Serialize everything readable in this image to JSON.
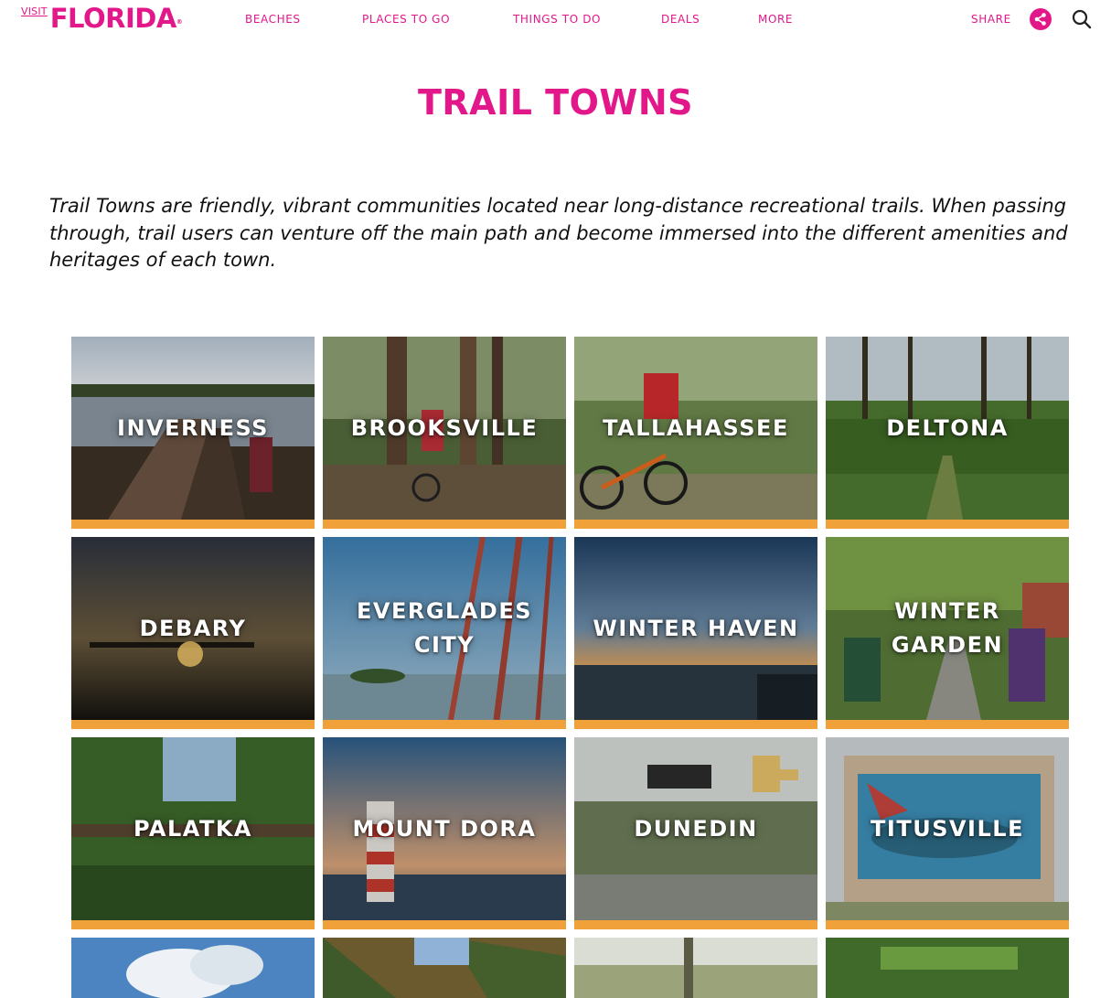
{
  "brand": {
    "visit": "VISIT",
    "name": "FLORIDA",
    "mark": "®",
    "color": "#e2178a"
  },
  "nav": [
    {
      "label": "BEACHES"
    },
    {
      "label": "PLACES TO GO"
    },
    {
      "label": "THINGS TO DO"
    },
    {
      "label": "DEALS"
    },
    {
      "label": "MORE"
    }
  ],
  "header_actions": {
    "share_label": "SHARE",
    "share_icon": "share-icon",
    "search_icon": "search-icon"
  },
  "page": {
    "title": "TRAIL TOWNS",
    "intro": "Trail Towns are friendly, vibrant communities located near long-distance recreational trails. When passing through, trail users can venture off the main path and become immersed into the different amenities and heritages of each town."
  },
  "colors": {
    "accent": "#e2178a",
    "tile_bar": "#f0a13a",
    "text": "#111111"
  },
  "towns": [
    {
      "name": "INVERNESS"
    },
    {
      "name": "BROOKSVILLE"
    },
    {
      "name": "TALLAHASSEE"
    },
    {
      "name": "DELTONA"
    },
    {
      "name": "DEBARY"
    },
    {
      "name": "EVERGLADES CITY"
    },
    {
      "name": "WINTER HAVEN"
    },
    {
      "name": "WINTER GARDEN"
    },
    {
      "name": "PALATKA"
    },
    {
      "name": "MOUNT DORA"
    },
    {
      "name": "DUNEDIN"
    },
    {
      "name": "TITUSVILLE"
    }
  ]
}
